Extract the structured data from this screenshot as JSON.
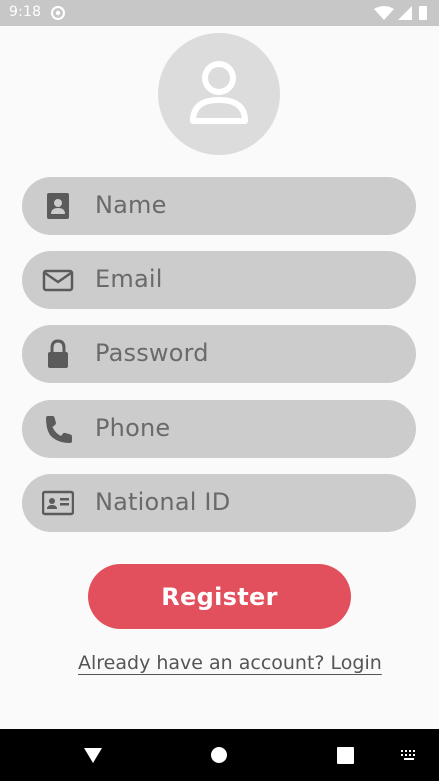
{
  "status_bar": {
    "time": "9:18",
    "icons": [
      "settings-circle-icon",
      "wifi-icon",
      "cellular-signal-icon",
      "battery-icon"
    ]
  },
  "avatar": {
    "icon": "person-icon"
  },
  "form": {
    "fields": [
      {
        "icon": "contact-card-icon",
        "placeholder": "Name"
      },
      {
        "icon": "envelope-icon",
        "placeholder": "Email"
      },
      {
        "icon": "lock-icon",
        "placeholder": "Password"
      },
      {
        "icon": "phone-icon",
        "placeholder": "Phone"
      },
      {
        "icon": "id-card-icon",
        "placeholder": "National ID"
      }
    ],
    "register_label": "Register",
    "login_text": "Already have an account? Login"
  },
  "colors": {
    "accent": "#e2505d",
    "field_bg": "#cccccc",
    "avatar_bg": "#dcdcdc",
    "page_bg": "#fafafa",
    "status_bar": "#c7c7c7"
  },
  "nav_bar": {
    "buttons": [
      "back-triangle-icon",
      "home-circle-icon",
      "recents-square-icon",
      "keyboard-icon"
    ]
  }
}
